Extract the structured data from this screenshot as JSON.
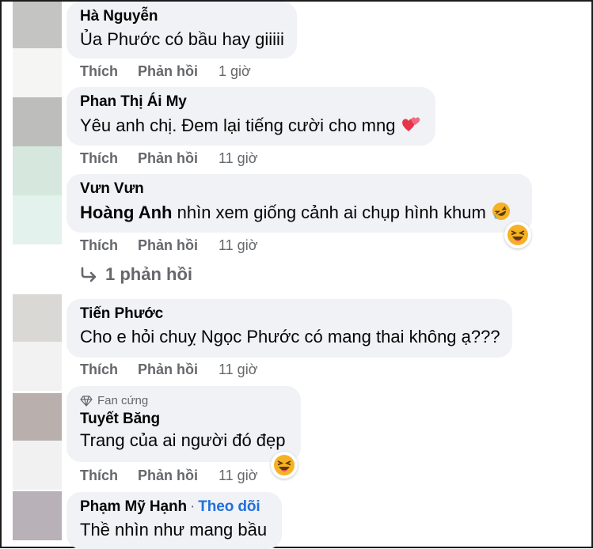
{
  "comments": [
    {
      "author": "Hà Nguyễn",
      "text": "Ủa Phước có bầu hay giiiii",
      "like": "Thích",
      "reply": "Phản hồi",
      "time": "1 giờ"
    },
    {
      "author": "Phan Thị Ái My",
      "text": "Yêu anh chị. Đem lại tiếng cười cho mng",
      "like": "Thích",
      "reply": "Phản hồi",
      "time": "11 giờ"
    },
    {
      "author": "Vưn Vưn",
      "mention": "Hoàng Anh",
      "text": "nhìn xem giống cảnh ai chụp hình khum",
      "like": "Thích",
      "reply": "Phản hồi",
      "time": "11 giờ",
      "replies": "1 phản hồi"
    },
    {
      "author": "Tiến Phước",
      "text": "Cho e hỏi chuỵ Ngọc Phước có mang thai không ạ???",
      "like": "Thích",
      "reply": "Phản hồi",
      "time": "11 giờ"
    },
    {
      "badge": "Fan cứng",
      "author": "Tuyết Băng",
      "text": "Trang của ai người đó đẹp",
      "like": "Thích",
      "reply": "Phản hồi",
      "time": "11 giờ"
    },
    {
      "author": "Phạm Mỹ Hạnh",
      "follow": "Theo dõi",
      "text": "Thề nhìn như mang bầu"
    }
  ],
  "icons": {
    "reply_arrow": "reply-arrow-icon",
    "heart": "two-hearts-emoji",
    "laugh": "rolling-laughing-emoji",
    "haha": "haha-reaction",
    "badge": "diamond-icon"
  },
  "colors": {
    "bubble": "#f0f2f5",
    "muted": "#65676b",
    "link": "#216fdb",
    "haha": "#f7b125"
  }
}
